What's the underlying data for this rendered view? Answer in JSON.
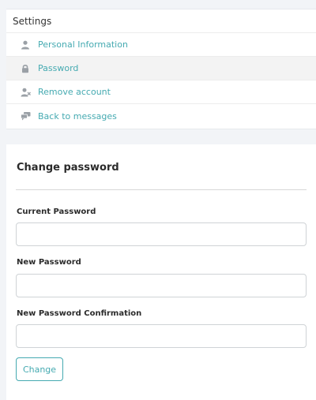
{
  "settings": {
    "title": "Settings",
    "items": [
      {
        "label": "Personal Information",
        "icon": "user-icon"
      },
      {
        "label": "Password",
        "icon": "lock-icon"
      },
      {
        "label": "Remove account",
        "icon": "remove-user-icon"
      },
      {
        "label": "Back to messages",
        "icon": "chat-bubbles-icon"
      }
    ],
    "active_index": 1
  },
  "form": {
    "title": "Change password",
    "current_password_label": "Current Password",
    "current_password_value": "",
    "new_password_label": "New Password",
    "new_password_value": "",
    "confirm_password_label": "New Password Confirmation",
    "confirm_password_value": "",
    "submit_label": "Change"
  },
  "colors": {
    "accent": "#45aab1",
    "icon": "#9aa0a6",
    "background": "#f2f4f7"
  }
}
